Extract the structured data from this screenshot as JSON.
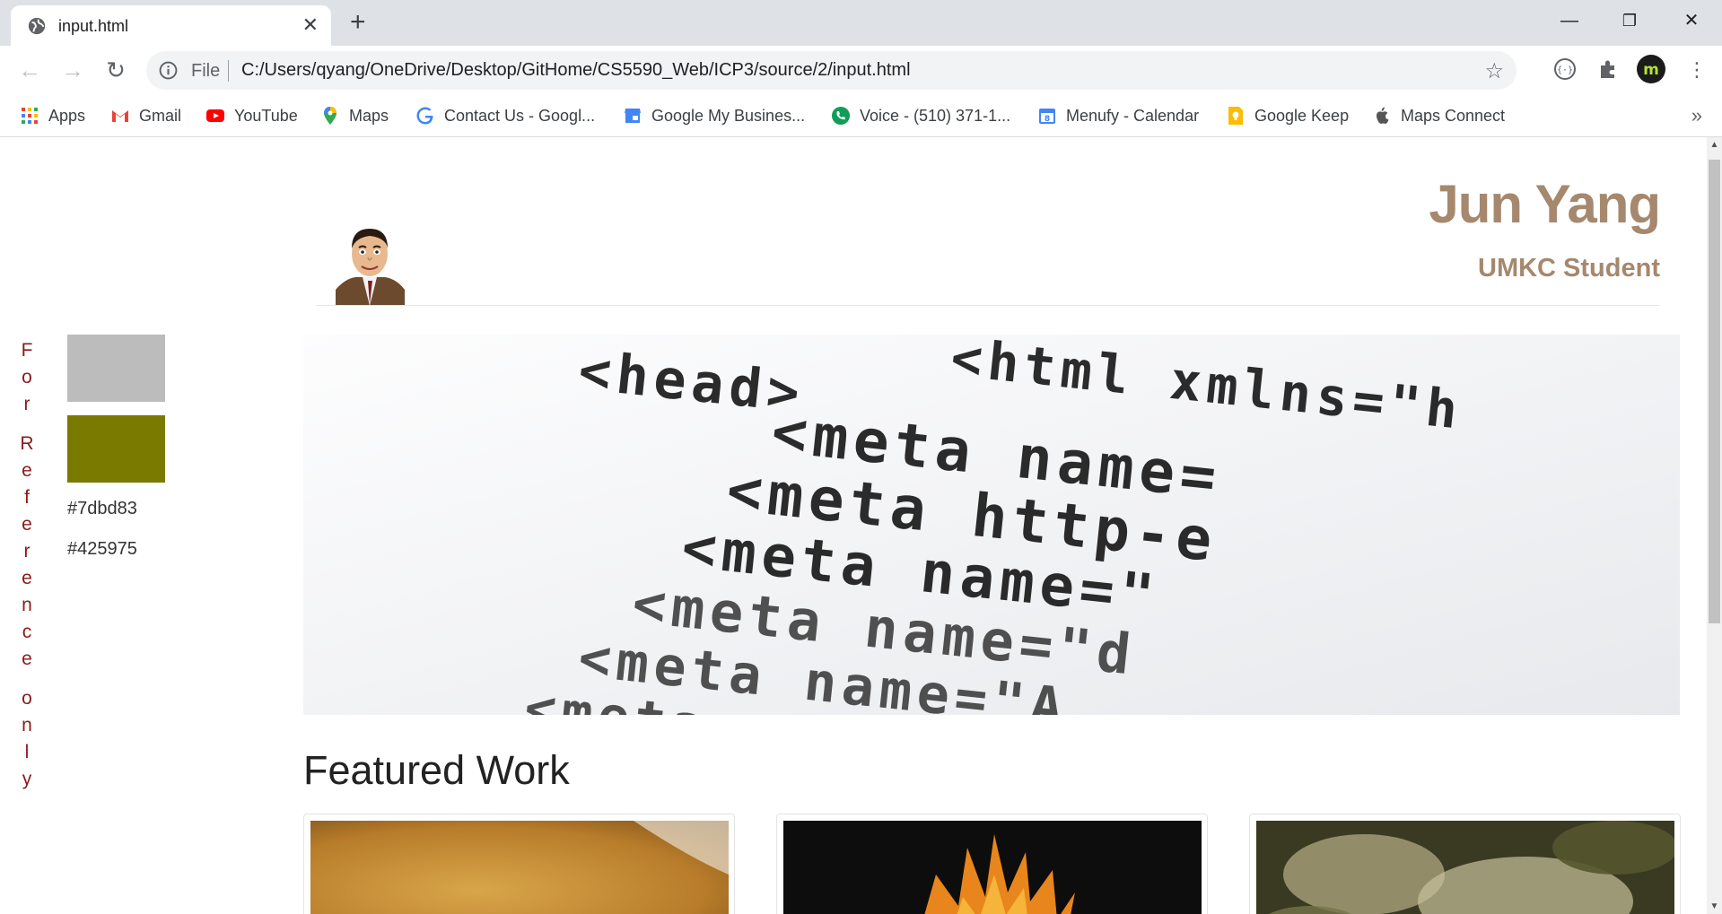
{
  "browser": {
    "tab_title": "input.html",
    "new_tab_label": "+",
    "url_scheme": "File",
    "url": "C:/Users/qyang/OneDrive/Desktop/GitHome/CS5590_Web/ICP3/source/2/input.html",
    "window_controls": [
      "minimize-icon",
      "restore-icon",
      "close-icon"
    ]
  },
  "bookmarks": [
    {
      "label": "Apps",
      "icon": "apps-grid-icon"
    },
    {
      "label": "Gmail",
      "icon": "gmail-icon"
    },
    {
      "label": "YouTube",
      "icon": "youtube-icon"
    },
    {
      "label": "Maps",
      "icon": "maps-pin-icon"
    },
    {
      "label": "Contact Us - Googl...",
      "icon": "google-g-icon"
    },
    {
      "label": "Google My Busines...",
      "icon": "my-business-icon"
    },
    {
      "label": "Voice - (510) 371-1...",
      "icon": "voice-icon"
    },
    {
      "label": "Menufy - Calendar",
      "icon": "calendar-icon"
    },
    {
      "label": "Google Keep",
      "icon": "keep-icon"
    },
    {
      "label": "Maps Connect",
      "icon": "apple-icon"
    }
  ],
  "bookmarks_overflow": "»",
  "page": {
    "reference_text": "For Reference only",
    "swatches": [
      {
        "color": "#bcbcbc"
      },
      {
        "color": "#7a7a00"
      }
    ],
    "swatch_labels": [
      "#7dbd83",
      "#425975"
    ],
    "name": "Jun Yang",
    "subtitle": "UMKC Student",
    "hero_lines": [
      "<html xmlns=\"h",
      "<head>",
      "<meta name=",
      "<meta http-e",
      "<meta name=\"",
      "<meta name=\"d",
      "<meta name=\"A",
      "<meta name=\"d"
    ],
    "featured_title": "Featured Work"
  },
  "colors": {
    "accent": "#a5886d",
    "reference_text": "#8b1a1a"
  }
}
